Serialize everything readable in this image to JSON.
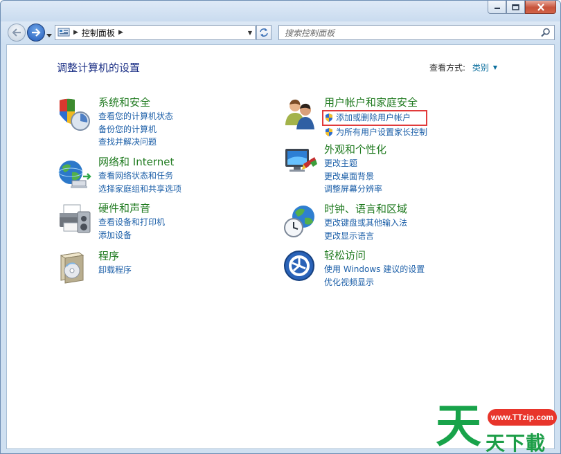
{
  "window": {
    "buttons": [
      "minimize",
      "maximize",
      "close"
    ]
  },
  "address": {
    "path": "控制面板",
    "search_placeholder": "搜索控制面板"
  },
  "page": {
    "title": "调整计算机的设置",
    "view_by_label": "查看方式:",
    "view_by_value": "类别"
  },
  "categories": {
    "system": {
      "title": "系统和安全",
      "links": [
        "查看您的计算机状态",
        "备份您的计算机",
        "查找并解决问题"
      ]
    },
    "network": {
      "title": "网络和 Internet",
      "links": [
        "查看网络状态和任务",
        "选择家庭组和共享选项"
      ]
    },
    "hardware": {
      "title": "硬件和声音",
      "links": [
        "查看设备和打印机",
        "添加设备"
      ]
    },
    "programs": {
      "title": "程序",
      "links": [
        "卸载程序"
      ]
    },
    "users": {
      "title": "用户帐户和家庭安全",
      "links": [
        "添加或删除用户帐户",
        "为所有用户设置家长控制"
      ]
    },
    "appearance": {
      "title": "外观和个性化",
      "links": [
        "更改主题",
        "更改桌面背景",
        "调整屏幕分辨率"
      ]
    },
    "clock": {
      "title": "时钟、语言和区域",
      "links": [
        "更改键盘或其他输入法",
        "更改显示语言"
      ]
    },
    "access": {
      "title": "轻松访问",
      "links": [
        "使用 Windows 建议的设置",
        "优化视频显示"
      ]
    }
  },
  "watermark": {
    "url": "www.TTzip.com",
    "big": "天",
    "small": "天下載"
  },
  "colors": {
    "category_title": "#1f7a1f",
    "link": "#1c5fa8",
    "page_title": "#1e3287",
    "highlight": "#e13a3a"
  }
}
